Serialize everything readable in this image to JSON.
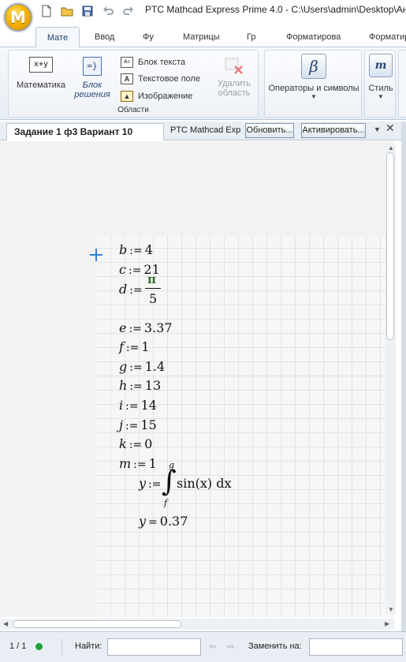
{
  "window": {
    "title": "PTC Mathcad Express Prime 4.0 - C:\\Users\\admin\\Desktop\\Анк",
    "logo_letter": "M"
  },
  "ribbon_tabs": [
    "Мате",
    "Ввод",
    "Фу",
    "Матрицы",
    "Гр",
    "Форматирова",
    "Форматир"
  ],
  "ribbon": {
    "math_label": "Математика",
    "math_icon_text": "x+y",
    "solve_block_label_1": "Блок",
    "solve_block_label_2": "решения",
    "text_block_label": "Блок текста",
    "text_field_label": "Текстовое поле",
    "image_label": "Изображение",
    "delete_region_label_1": "Удалить",
    "delete_region_label_2": "область",
    "regions_group_label": "Области",
    "operators_label": "Операторы и символы",
    "operators_icon": "β",
    "style_label": "Стиль",
    "style_icon": "m"
  },
  "document": {
    "tab_title": "Задание 1 ф3 Вариант 10",
    "info_text": "PTC Mathcad Exp",
    "update_button": "Обновить...",
    "activate_button": "Активировать..."
  },
  "worksheet": {
    "assignments": [
      {
        "name": "b",
        "op": ":=",
        "value": "4"
      },
      {
        "name": "c",
        "op": ":=",
        "value": "21"
      },
      {
        "name": "e",
        "op": ":=",
        "value": "3.37"
      },
      {
        "name": "f",
        "op": ":=",
        "value": "1"
      },
      {
        "name": "g",
        "op": ":=",
        "value": "1.4"
      },
      {
        "name": "h",
        "op": ":=",
        "value": "13"
      },
      {
        "name": "i",
        "op": ":=",
        "value": "14"
      },
      {
        "name": "j",
        "op": ":=",
        "value": "15"
      },
      {
        "name": "k",
        "op": ":=",
        "value": "0"
      },
      {
        "name": "m",
        "op": ":=",
        "value": "1"
      }
    ],
    "d_name": "d",
    "d_op": ":=",
    "d_numerator": "π",
    "d_denominator": "5",
    "integral": {
      "lhs": "y",
      "op": ":=",
      "upper": "g",
      "lower": "f",
      "integrand": "sin(x) dx"
    },
    "result": {
      "lhs": "y",
      "op": "=",
      "value": "0.37"
    }
  },
  "status": {
    "page": "1 / 1",
    "find_label": "Найти:",
    "replace_label": "Заменить на:",
    "status_color": "#1fa23a"
  }
}
